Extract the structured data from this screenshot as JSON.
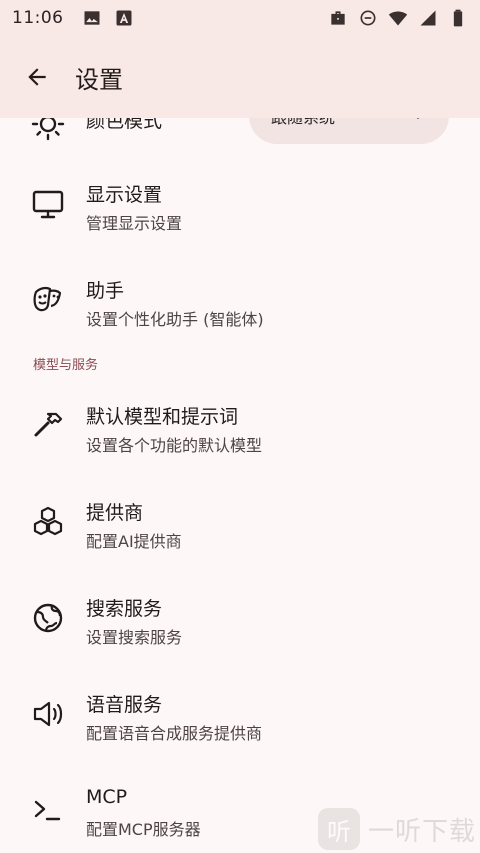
{
  "status_bar": {
    "time": "11:06",
    "left_icons": [
      "image-icon",
      "text-a-icon"
    ],
    "right_icons": [
      "briefcase-icon",
      "do-not-disturb-icon",
      "wifi-icon",
      "signal-icon",
      "battery-icon"
    ]
  },
  "app_bar": {
    "title": "设置",
    "back_icon": "arrow-back-icon"
  },
  "partial_row": {
    "icon": "sun-icon",
    "title": "颜色模式",
    "dropdown_value": "跟随系统"
  },
  "rows_top": [
    {
      "icon": "monitor-icon",
      "title": "显示设置",
      "subtitle": "管理显示设置"
    },
    {
      "icon": "mask-icon",
      "title": "助手",
      "subtitle": "设置个性化助手 (智能体)"
    }
  ],
  "section": {
    "title": "模型与服务"
  },
  "rows_bottom": [
    {
      "icon": "hammer-icon",
      "title": "默认模型和提示词",
      "subtitle": "设置各个功能的默认模型"
    },
    {
      "icon": "boxes-icon",
      "title": "提供商",
      "subtitle": "配置AI提供商"
    },
    {
      "icon": "globe-icon",
      "title": "搜索服务",
      "subtitle": "设置搜索服务"
    },
    {
      "icon": "speaker-icon",
      "title": "语音服务",
      "subtitle": "配置语音合成服务提供商"
    },
    {
      "icon": "terminal-icon",
      "title": "MCP",
      "subtitle": "配置MCP服务器"
    }
  ],
  "watermark": {
    "badge": "听",
    "text": "一听下载"
  },
  "colors": {
    "background": "#fdf8f7",
    "app_bar": "#f8e8e6",
    "section_header": "#8c4a52",
    "dropdown_bg": "#f1e4e2"
  }
}
